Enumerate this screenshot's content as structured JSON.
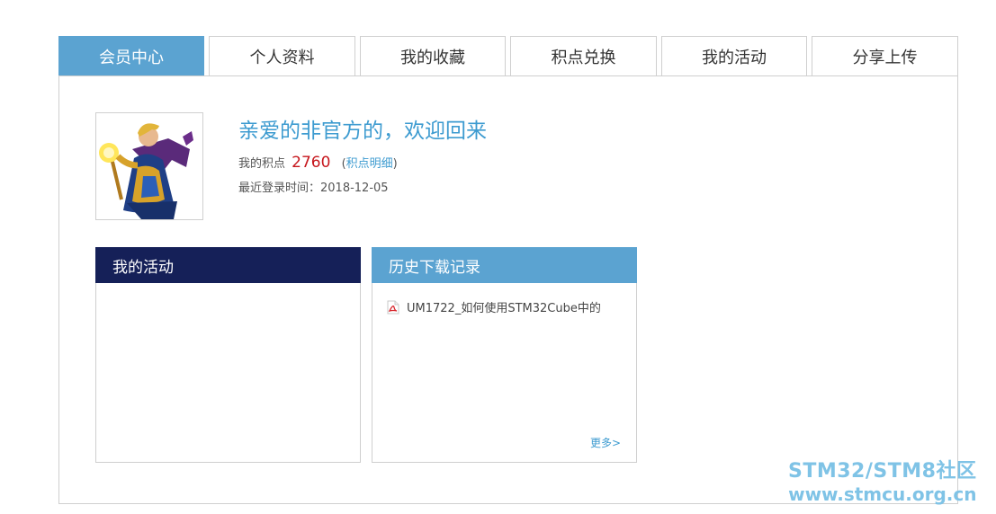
{
  "tabs": [
    {
      "label": "会员中心",
      "active": true
    },
    {
      "label": "个人资料",
      "active": false
    },
    {
      "label": "我的收藏",
      "active": false
    },
    {
      "label": "积点兑换",
      "active": false
    },
    {
      "label": "我的活动",
      "active": false
    },
    {
      "label": "分享上传",
      "active": false
    }
  ],
  "profile": {
    "welcome": "亲爱的非官方的，欢迎回来",
    "points_label": "我的积点",
    "points_value": "2760",
    "points_detail_open": "(",
    "points_detail_link": "积点明细",
    "points_detail_close": ")",
    "last_login": "最近登录时间：2018-12-05"
  },
  "activity_box": {
    "title": "我的活动",
    "header_color": "#152058"
  },
  "downloads_box": {
    "title": "历史下载记录",
    "header_color": "#5ba3d1",
    "items": [
      {
        "title": "UM1722_如何使用STM32Cube中的",
        "icon": "pdf-icon"
      }
    ],
    "more_label": "更多>"
  },
  "watermark": {
    "line1": "STM32/STM8社区",
    "line2": "www.stmcu.org.cn"
  },
  "colors": {
    "accent": "#5ba3d1",
    "link": "#3d9bd0",
    "points": "#c6161c",
    "dark_header": "#152058"
  }
}
